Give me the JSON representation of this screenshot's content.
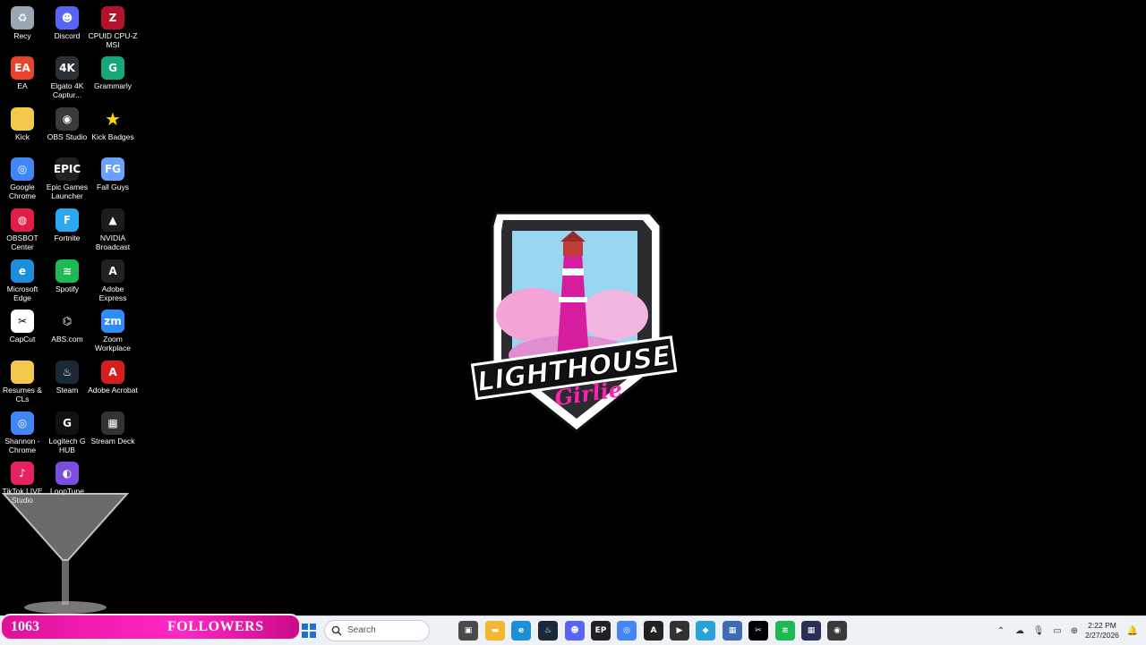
{
  "desktop": {
    "icons": [
      {
        "id": "recycle-bin",
        "label": "Recy",
        "icon": "recycle-bin-icon",
        "color": "#9aa6b2",
        "glyph": "♻"
      },
      {
        "id": "discord",
        "label": "Discord",
        "icon": "discord-icon",
        "color": "#5865f2",
        "glyph": "☻"
      },
      {
        "id": "cpuid",
        "label": "CPUID CPU-Z MSI",
        "icon": "cpuz-icon",
        "color": "#b3132a",
        "glyph": "Z"
      },
      {
        "id": "ea",
        "label": "EA",
        "icon": "ea-icon",
        "color": "#e7432f",
        "glyph": "EA"
      },
      {
        "id": "elgato",
        "label": "Elgato 4K Captur...",
        "icon": "elgato-icon",
        "color": "#2b2f36",
        "glyph": "4K"
      },
      {
        "id": "grammarly",
        "label": "Grammarly",
        "icon": "grammarly-icon",
        "color": "#15a87a",
        "glyph": "G"
      },
      {
        "id": "kick",
        "label": "Kick",
        "icon": "folder-icon",
        "color": "#f2c94c",
        "glyph": ""
      },
      {
        "id": "obs",
        "label": "OBS Studio",
        "icon": "obs-icon",
        "color": "#3a3a3a",
        "glyph": "◉"
      },
      {
        "id": "kick-badges",
        "label": "Kick Badges",
        "icon": "star-icon",
        "color": "#000000",
        "glyph": "★"
      },
      {
        "id": "chrome",
        "label": "Google Chrome",
        "icon": "chrome-icon",
        "color": "#4285f4",
        "glyph": "◎"
      },
      {
        "id": "epic",
        "label": "Epic Games Launcher",
        "icon": "epic-games-icon",
        "color": "#222222",
        "glyph": "EPIC"
      },
      {
        "id": "fallguys",
        "label": "Fall Guys",
        "icon": "fall-guys-icon",
        "color": "#6aa0ff",
        "glyph": "FG"
      },
      {
        "id": "obsbot",
        "label": "OBSBOT Center",
        "icon": "obsbot-icon",
        "color": "#e11d48",
        "glyph": "◍"
      },
      {
        "id": "fortnite",
        "label": "Fortnite",
        "icon": "fortnite-icon",
        "color": "#2aa8f2",
        "glyph": "F"
      },
      {
        "id": "nvidia",
        "label": "NVIDIA Broadcast",
        "icon": "nvidia-icon",
        "color": "#1c1c1c",
        "glyph": "▲"
      },
      {
        "id": "edge",
        "label": "Microsoft Edge",
        "icon": "edge-icon",
        "color": "#1b8fd9",
        "glyph": "e"
      },
      {
        "id": "spotify",
        "label": "Spotify",
        "icon": "spotify-icon",
        "color": "#1db954",
        "glyph": "≋"
      },
      {
        "id": "adobe-express",
        "label": "Adobe Express",
        "icon": "adobe-express-icon",
        "color": "#222222",
        "glyph": "A"
      },
      {
        "id": "capcut",
        "label": "CapCut",
        "icon": "capcut-icon",
        "color": "#ffffff",
        "glyph": "✂"
      },
      {
        "id": "abs",
        "label": "ABS.com",
        "icon": "abs-icon",
        "color": "#000000",
        "glyph": "⌬"
      },
      {
        "id": "zoom",
        "label": "Zoom Workplace",
        "icon": "zoom-icon",
        "color": "#2d8cff",
        "glyph": "zm"
      },
      {
        "id": "resumes",
        "label": "Resumes & CLs",
        "icon": "folder-icon",
        "color": "#f2c94c",
        "glyph": ""
      },
      {
        "id": "steam",
        "label": "Steam",
        "icon": "steam-icon",
        "color": "#1b2838",
        "glyph": "♨"
      },
      {
        "id": "acrobat",
        "label": "Adobe Acrobat",
        "icon": "acrobat-icon",
        "color": "#d71e1e",
        "glyph": "A"
      },
      {
        "id": "shannon-chrome",
        "label": "Shannon - Chrome",
        "icon": "chrome-icon",
        "color": "#4285f4",
        "glyph": "◎"
      },
      {
        "id": "logitech",
        "label": "Logitech G HUB",
        "icon": "logitech-icon",
        "color": "#111111",
        "glyph": "G"
      },
      {
        "id": "streamdeck",
        "label": "Stream Deck",
        "icon": "stream-deck-icon",
        "color": "#333333",
        "glyph": "▦"
      },
      {
        "id": "tiktok",
        "label": "TikTok LIVE Studio",
        "icon": "tiktok-icon",
        "color": "#e5245f",
        "glyph": "♪"
      },
      {
        "id": "looptune",
        "label": "LoopTune",
        "icon": "looptune-icon",
        "color": "#7b4de0",
        "glyph": "◐"
      }
    ],
    "logo_text": {
      "line1": "LIGHTHOUSE",
      "line2": "Girlie"
    }
  },
  "overlay": {
    "followers_count": "1063",
    "followers_label": "FOLLOWERS",
    "followers_goal": "1500",
    "bar_color": "#e0109a"
  },
  "taskbar": {
    "search_placeholder": "Search",
    "apps": [
      {
        "name": "task-view",
        "icon": "task-view-icon",
        "color": "#4a4a4a",
        "glyph": "▣"
      },
      {
        "name": "file-explorer",
        "icon": "file-explorer-icon",
        "color": "#f2b630",
        "glyph": "▬"
      },
      {
        "name": "edge",
        "icon": "edge-icon",
        "color": "#1b8fd9",
        "glyph": "e"
      },
      {
        "name": "steam",
        "icon": "steam-icon",
        "color": "#1b2838",
        "glyph": "♨"
      },
      {
        "name": "discord",
        "icon": "discord-icon",
        "color": "#5865f2",
        "glyph": "☻"
      },
      {
        "name": "epic-games",
        "icon": "epic-games-icon",
        "color": "#222222",
        "glyph": "EP"
      },
      {
        "name": "chrome",
        "icon": "chrome-icon",
        "color": "#4285f4",
        "glyph": "◎"
      },
      {
        "name": "adobe-express",
        "icon": "adobe-express-icon",
        "color": "#222222",
        "glyph": "A"
      },
      {
        "name": "media-player",
        "icon": "play-icon",
        "color": "#333333",
        "glyph": "▶"
      },
      {
        "name": "store",
        "icon": "store-icon",
        "color": "#29a3d6",
        "glyph": "◆"
      },
      {
        "name": "calculator",
        "icon": "calculator-icon",
        "color": "#3d6db0",
        "glyph": "▦"
      },
      {
        "name": "capcut",
        "icon": "capcut-icon",
        "color": "#000000",
        "glyph": "✂"
      },
      {
        "name": "spotify",
        "icon": "spotify-icon",
        "color": "#1db954",
        "glyph": "≋"
      },
      {
        "name": "streamdeck",
        "icon": "stream-deck-icon",
        "color": "#2b2f55",
        "glyph": "▦"
      },
      {
        "name": "obs",
        "icon": "obs-icon",
        "color": "#3a3a3a",
        "glyph": "◉"
      }
    ],
    "tray": [
      {
        "name": "show-hidden",
        "icon": "chevron-up-icon",
        "glyph": "⌃"
      },
      {
        "name": "onedrive",
        "icon": "cloud-off-icon",
        "glyph": "☁"
      },
      {
        "name": "microphone",
        "icon": "microphone-icon",
        "glyph": "🎙"
      },
      {
        "name": "display",
        "icon": "display-icon",
        "glyph": "▭"
      },
      {
        "name": "network",
        "icon": "network-icon",
        "glyph": "⊕"
      },
      {
        "name": "volume",
        "icon": "volume-icon",
        "glyph": "🔊"
      }
    ],
    "clock": {
      "time": "2:22 PM",
      "date": "2/27/2026"
    },
    "notification": {
      "icon": "bell-icon",
      "glyph": "🔔"
    }
  }
}
